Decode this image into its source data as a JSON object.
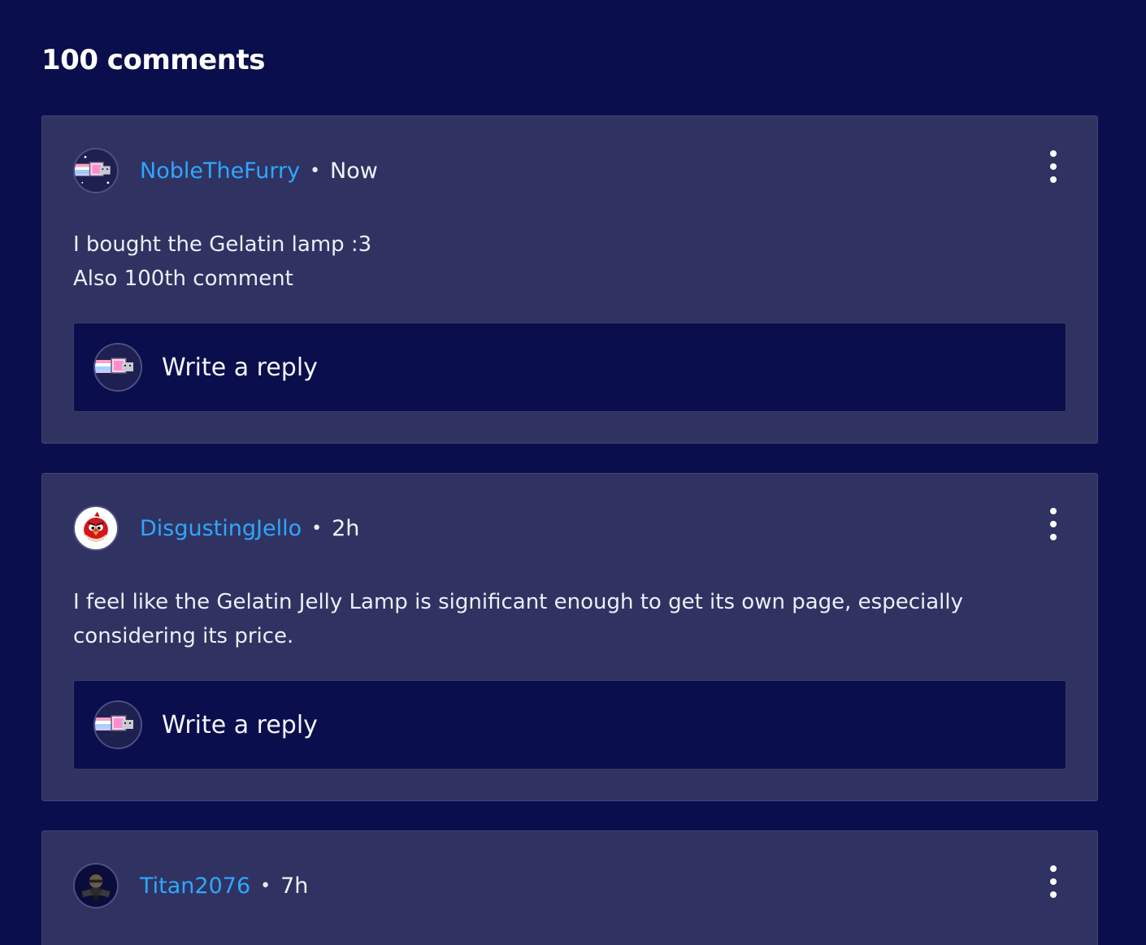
{
  "heading": "100 comments",
  "comments": [
    {
      "username": "NobleTheFurry",
      "separator": "•",
      "time": "Now",
      "body": "I bought the Gelatin lamp :3\nAlso 100th comment",
      "reply_placeholder": "Write a reply"
    },
    {
      "username": "DisgustingJello",
      "separator": "•",
      "time": "2h",
      "body": "I feel like the Gelatin Jelly Lamp is significant enough to get its own page, especially\nconsidering its price.",
      "reply_placeholder": "Write a reply"
    },
    {
      "username": "Titan2076",
      "separator": "•",
      "time": "7h"
    }
  ],
  "colors": {
    "page_background": "#0b0e4c",
    "card_background": "#303361",
    "username": "#2fa6ff",
    "text": "#eceef8"
  },
  "icons": {
    "avatar_1": "nyan-cat-avatar",
    "avatar_2": "red-angry-bird-avatar",
    "avatar_3": "titan-robot-avatar",
    "more_menu": "vertical-ellipsis-icon"
  }
}
